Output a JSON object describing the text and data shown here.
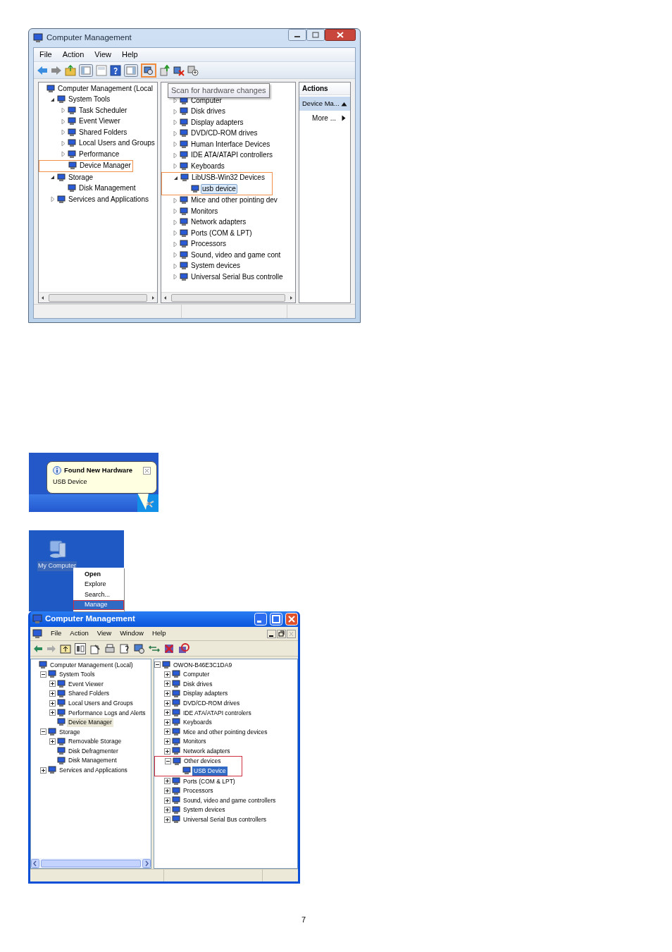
{
  "win7": {
    "title": "Computer Management",
    "menu": [
      "File",
      "Action",
      "View",
      "Help"
    ],
    "tooltip": "Scan for hardware changes",
    "left_tree": [
      {
        "label": "Computer Management (Local",
        "selected": false,
        "highlighted": false,
        "children": [
          {
            "label": "System Tools",
            "expanded": true,
            "selected": false,
            "highlighted": false,
            "children": [
              {
                "label": "Task Scheduler",
                "expanded": false,
                "selected": false,
                "highlighted": false
              },
              {
                "label": "Event Viewer",
                "expanded": false,
                "selected": false,
                "highlighted": false
              },
              {
                "label": "Shared Folders",
                "expanded": false,
                "selected": false,
                "highlighted": false
              },
              {
                "label": "Local Users and Groups",
                "expanded": false,
                "selected": false,
                "highlighted": false
              },
              {
                "label": "Performance",
                "expanded": false,
                "selected": false,
                "highlighted": false
              },
              {
                "label": "Device Manager",
                "selected": false,
                "highlighted": true
              }
            ]
          },
          {
            "label": "Storage",
            "expanded": true,
            "selected": false,
            "highlighted": false,
            "children": [
              {
                "label": "Disk Management",
                "selected": false,
                "highlighted": false
              }
            ]
          },
          {
            "label": "Services and Applications",
            "expanded": false,
            "selected": false,
            "highlighted": false
          }
        ]
      }
    ],
    "device_tree": [
      {
        "label": "Computer",
        "expanded": false,
        "selected": false,
        "highlighted": false
      },
      {
        "label": "Disk drives",
        "expanded": false,
        "selected": false,
        "highlighted": false
      },
      {
        "label": "Display adapters",
        "expanded": false,
        "selected": false,
        "highlighted": false
      },
      {
        "label": "DVD/CD-ROM drives",
        "expanded": false,
        "selected": false,
        "highlighted": false
      },
      {
        "label": "Human Interface Devices",
        "expanded": false,
        "selected": false,
        "highlighted": false
      },
      {
        "label": "IDE ATA/ATAPI controllers",
        "expanded": false,
        "selected": false,
        "highlighted": false
      },
      {
        "label": "Keyboards",
        "expanded": false,
        "selected": false,
        "highlighted": false
      },
      {
        "label": "LibUSB-Win32 Devices",
        "expanded": true,
        "selected": false,
        "highlighted": true,
        "children": [
          {
            "label": "usb device",
            "selected": true,
            "highlighted": false
          }
        ]
      },
      {
        "label": "Mice and other pointing dev",
        "expanded": false,
        "selected": false,
        "highlighted": false
      },
      {
        "label": "Monitors",
        "expanded": false,
        "selected": false,
        "highlighted": false
      },
      {
        "label": "Network adapters",
        "expanded": false,
        "selected": false,
        "highlighted": false
      },
      {
        "label": "Ports (COM & LPT)",
        "expanded": false,
        "selected": false,
        "highlighted": false
      },
      {
        "label": "Processors",
        "expanded": false,
        "selected": false,
        "highlighted": false
      },
      {
        "label": "Sound, video and game cont",
        "expanded": false,
        "selected": false,
        "highlighted": false
      },
      {
        "label": "System devices",
        "expanded": false,
        "selected": false,
        "highlighted": false
      },
      {
        "label": "Universal Serial Bus controlle",
        "expanded": false,
        "selected": false,
        "highlighted": false
      }
    ],
    "actions": {
      "title": "Actions",
      "section": "Device Ma...",
      "more": "More ..."
    }
  },
  "balloon": {
    "title": "Found New Hardware",
    "body": "USB Device"
  },
  "desktop": {
    "icon_label": "My Computer",
    "menu": [
      {
        "label": "Open",
        "selected": false,
        "default": true
      },
      {
        "label": "Explore",
        "selected": false,
        "default": false
      },
      {
        "label": "Search...",
        "selected": false,
        "default": false
      },
      {
        "label": "Manage",
        "selected": true,
        "default": false
      }
    ]
  },
  "winxp": {
    "title": "Computer Management",
    "menu": [
      "File",
      "Action",
      "View",
      "Window",
      "Help"
    ],
    "left_tree": [
      {
        "label": "Computer Management (Local)",
        "selected": false,
        "highlighted": false,
        "children": [
          {
            "label": "System Tools",
            "expanded": true,
            "selected": false,
            "highlighted": false,
            "children": [
              {
                "label": "Event Viewer",
                "expanded": false,
                "selected": false,
                "highlighted": false
              },
              {
                "label": "Shared Folders",
                "expanded": false,
                "selected": false,
                "highlighted": false
              },
              {
                "label": "Local Users and Groups",
                "expanded": false,
                "selected": false,
                "highlighted": false
              },
              {
                "label": "Performance Logs and Alerts",
                "expanded": false,
                "selected": false,
                "highlighted": false
              },
              {
                "label": "Device Manager",
                "selected": true,
                "highlighted": false
              }
            ]
          },
          {
            "label": "Storage",
            "expanded": true,
            "selected": false,
            "highlighted": false,
            "children": [
              {
                "label": "Removable Storage",
                "expanded": false,
                "selected": false,
                "highlighted": false
              },
              {
                "label": "Disk Defragmenter",
                "selected": false,
                "highlighted": false
              },
              {
                "label": "Disk Management",
                "selected": false,
                "highlighted": false
              }
            ]
          },
          {
            "label": "Services and Applications",
            "expanded": false,
            "selected": false,
            "highlighted": false
          }
        ]
      }
    ],
    "device_tree": [
      {
        "label": "OWON-B46E3C1DA9",
        "expanded": true,
        "selected": false,
        "highlighted": false,
        "children": [
          {
            "label": "Computer",
            "expanded": false,
            "selected": false,
            "highlighted": false
          },
          {
            "label": "Disk drives",
            "expanded": false,
            "selected": false,
            "highlighted": false
          },
          {
            "label": "Display adapters",
            "expanded": false,
            "selected": false,
            "highlighted": false
          },
          {
            "label": "DVD/CD-ROM drives",
            "expanded": false,
            "selected": false,
            "highlighted": false
          },
          {
            "label": "IDE ATA/ATAPI controlers",
            "expanded": false,
            "selected": false,
            "highlighted": false
          },
          {
            "label": "Keyboards",
            "expanded": false,
            "selected": false,
            "highlighted": false
          },
          {
            "label": "Mice and other pointing devices",
            "expanded": false,
            "selected": false,
            "highlighted": false
          },
          {
            "label": "Monitors",
            "expanded": false,
            "selected": false,
            "highlighted": false
          },
          {
            "label": "Network adapters",
            "expanded": false,
            "selected": false,
            "highlighted": false
          },
          {
            "label": "Other devices",
            "expanded": true,
            "selected": false,
            "highlighted": true,
            "children": [
              {
                "label": "USB Device",
                "selected": true,
                "highlighted": false
              }
            ]
          },
          {
            "label": "Ports (COM & LPT)",
            "expanded": false,
            "selected": false,
            "highlighted": false
          },
          {
            "label": "Processors",
            "expanded": false,
            "selected": false,
            "highlighted": false
          },
          {
            "label": "Sound, video and game controllers",
            "expanded": false,
            "selected": false,
            "highlighted": false
          },
          {
            "label": "System devices",
            "expanded": false,
            "selected": false,
            "highlighted": false
          },
          {
            "label": "Universal Serial Bus controllers",
            "expanded": false,
            "selected": false,
            "highlighted": false
          }
        ]
      }
    ]
  },
  "page_number": "7"
}
